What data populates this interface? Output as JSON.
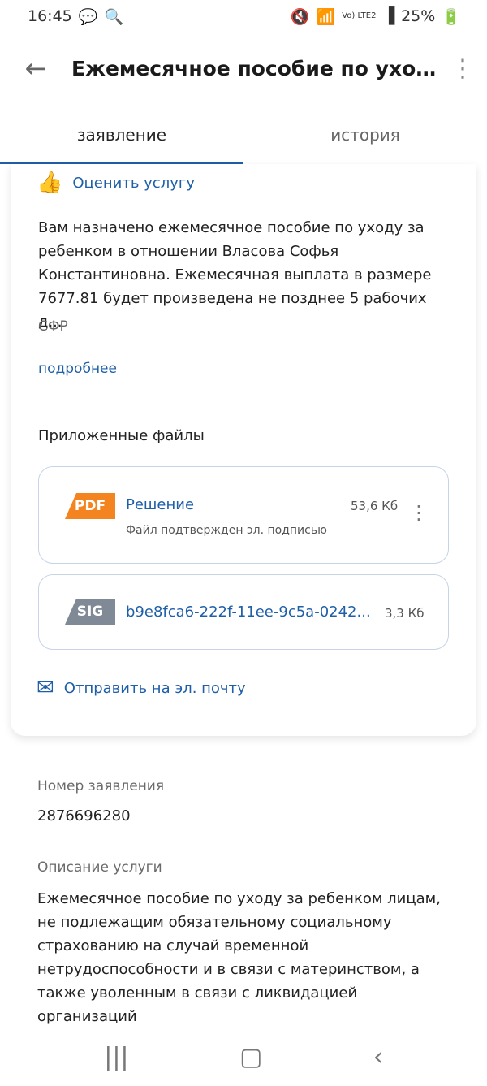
{
  "status": {
    "time": "16:45",
    "left_icons": [
      "chat-icon",
      "search-icon"
    ],
    "signal_text": "Vo) LTE2",
    "battery": "25%"
  },
  "header": {
    "title": "Ежемесячное пособие по уход..."
  },
  "tabs": [
    {
      "label": "заявление",
      "active": true
    },
    {
      "label": "история",
      "active": false
    }
  ],
  "card": {
    "rate_label": "Оценить услугу",
    "message": "Вам назначено ежемесячное пособие по уходу за ребенком в отношении Власова Софья Константиновна. Ежемесячная выплата в размере 7677.81 будет произведена не позднее 5 рабочих д...",
    "source": "СФР",
    "more_link": "подробнее",
    "files_title": "Приложенные файлы",
    "files": [
      {
        "badge": "PDF",
        "name": "Решение",
        "subtitle": "Файл подтвержден эл. подписью",
        "size": "53,6 Кб"
      },
      {
        "badge": "SIG",
        "name": "b9e8fca6-222f-11ee-9c5a-0242...",
        "size": "3,3 Кб"
      }
    ],
    "email_label": "Отправить на эл. почту"
  },
  "details": {
    "app_number_label": "Номер заявления",
    "app_number": "2876696280",
    "service_desc_label": "Описание услуги",
    "service_desc": "Ежемесячное пособие по уходу за ребенком лицам, не подлежащим обязательному социальному страхованию на случай временной нетрудоспособности и в связи с материнством, а также уволенным в связи с ликвидацией организаций"
  },
  "nav": [
    "recents-icon",
    "home-icon",
    "back-icon"
  ],
  "colors": {
    "accent": "#1f5fa8",
    "pdf": "#f4841f",
    "sig": "#7f8a96"
  }
}
